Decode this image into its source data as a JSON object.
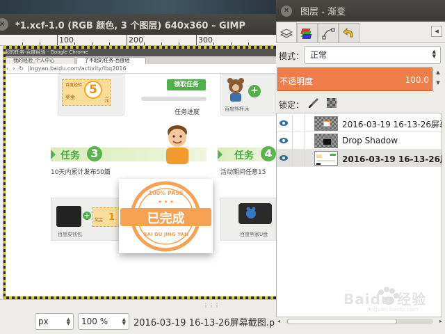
{
  "gimp": {
    "title": "*1.xcf-1.0 (RGB 颜色, 3 个图层) 640x360 – GIMP",
    "ruler_labels": [
      "100",
      "200",
      "300"
    ],
    "status": {
      "unit": "px",
      "zoom": "100 %",
      "text": "2016-03-19 16-13-26屏幕截图.p"
    }
  },
  "screenshot_content": {
    "chrome_title": "起的任务-百度经验 - Google Chrome",
    "tabs": [
      "我的经验_个人中心",
      "了不起的任务-百度经"
    ],
    "url": "jingyan.baidu.com/activity/lbq2016",
    "coupon_top": {
      "label_top": "百度经验",
      "label": "奖金",
      "amount": "5",
      "unit": "元"
    },
    "claim_button": "领取任务",
    "progress_label": "任务进度",
    "wallet_caption_1": "百度熊杯沐",
    "task3": {
      "label": "任务",
      "num": "3",
      "desc": "10天内累计发布50篇"
    },
    "task4": {
      "label": "任务",
      "num": "4",
      "desc": "活动期间任意15"
    },
    "coupon_bottom": {
      "label": "奖金",
      "amount": "1"
    },
    "plus": "+",
    "caption_wallet": "百度皮钱包",
    "caption_udisk": "百度熊家U盘",
    "stamp": {
      "top": "100% PASS",
      "main": "已完成",
      "bottom": "BAI DU JING YAN",
      "stars": "★ ★ ★"
    }
  },
  "dock": {
    "title": "图层 - 渐变",
    "mode_label": "模式：",
    "mode_value": "正常",
    "opacity_label": "不透明度",
    "opacity_value": "100.0",
    "lock_label": "锁定：",
    "layers": [
      {
        "name": "2016-03-19 16-13-26屏幕截",
        "selected": false
      },
      {
        "name": "Drop Shadow",
        "selected": false
      },
      {
        "name": "2016-03-19 16-13-26屏幕截",
        "selected": true
      }
    ]
  },
  "watermark": {
    "text": "Baidu 经验",
    "sub": "jingyan.baidu.com"
  },
  "colors": {
    "opacity_bar": "#f07e4a",
    "stamp_orange": "#f5a255",
    "task_green": "#4fb04a",
    "titlebar": "#3c3b37"
  },
  "icons": {
    "close": "close-icon",
    "eye": "eye-icon",
    "brush": "paint-brush-icon",
    "alpha": "alpha-lock-icon"
  }
}
